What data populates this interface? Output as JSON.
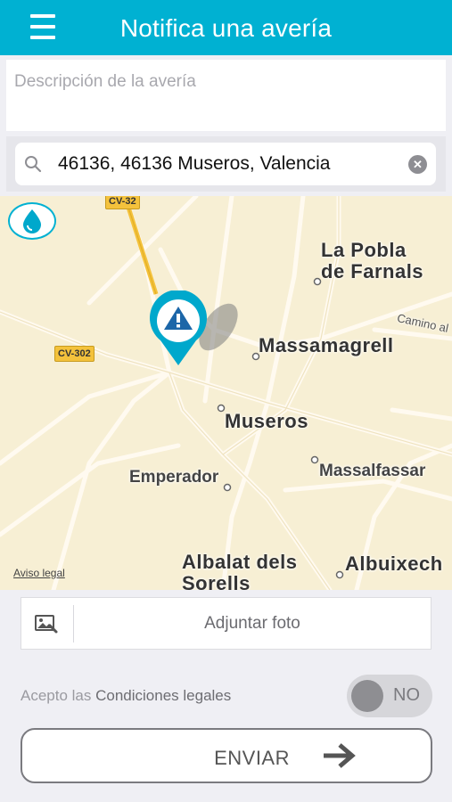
{
  "header": {
    "title": "Notifica una avería"
  },
  "description": {
    "placeholder": "Descripción de la avería",
    "value": ""
  },
  "search": {
    "value": "46136, 46136 Museros, Valencia"
  },
  "map": {
    "labels": {
      "la_pobla": "La Pobla",
      "de_farnals": "de Farnals",
      "massamagrell": "Massamagrell",
      "museros": "Museros",
      "massalfassar": "Massalfassar",
      "emperador": "Emperador",
      "albalat": "Albalat dels",
      "sorells": "Sorells",
      "albuixech": "Albuixech",
      "camino": "Camino al"
    },
    "road_badges": {
      "cv32": "CV-32",
      "cv302": "CV-302"
    },
    "legal_link": "Aviso legal"
  },
  "attach": {
    "label": "Adjuntar foto"
  },
  "terms": {
    "prefix": "Acepto las ",
    "link": "Condiciones legales"
  },
  "toggle": {
    "state": "NO"
  },
  "send": {
    "label": "ENVIAR"
  },
  "colors": {
    "accent": "#00b1d2",
    "map_bg": "#f7efd4",
    "road": "#f4c23c"
  }
}
